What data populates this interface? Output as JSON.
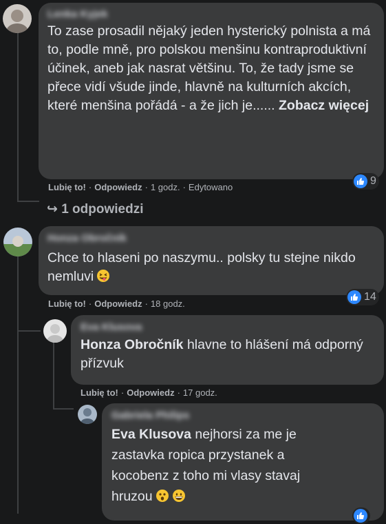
{
  "comments": [
    {
      "author": "Lenka Kyjek",
      "text": "To zase prosadil nějaký jeden hysterický polnista a má to, podle mně, pro polskou menšinu kontraproduktivní účinek, aneb jak nasrat většinu. To, že tady jsme se přece vidí všude jinde, hlavně na kulturních akcích, které menšina pořádá - a že jich je......",
      "see_more": "Zobacz więcej",
      "like_label": "Lubię to!",
      "reply_label": "Odpowiedz",
      "time": "1 godz.",
      "edited": "Edytowano",
      "reaction_count": "9",
      "replies_link": "1 odpowiedzi"
    },
    {
      "author": "Honza Obročník",
      "text": "Chce to hlaseni po naszymu.. polsky tu stejne nikdo nemluvi",
      "emoji": "squinting-tongue-emoji",
      "like_label": "Lubię to!",
      "reply_label": "Odpowiedz",
      "time": "18 godz.",
      "reaction_count": "14"
    },
    {
      "author": "Eva Klusova",
      "mention": "Honza Obročník",
      "text": "hlavne to hlášení má odporný přízvuk",
      "like_label": "Lubię to!",
      "reply_label": "Odpowiedz",
      "time": "17 godz."
    },
    {
      "author": "Gabriela Philips",
      "mention": "Eva Klusova",
      "text": "nejhorsi za me je zastavka ropica przystanek a kocobenz z toho mi vlasy stavaj hruzou",
      "emojis": [
        "astonished-emoji",
        "grinning-emoji"
      ]
    }
  ],
  "colors": {
    "background": "#18191a",
    "bubble": "#3a3b3c",
    "text": "#e4e6eb",
    "secondary": "#b0b3b8",
    "like_blue": "#2d88ff"
  }
}
